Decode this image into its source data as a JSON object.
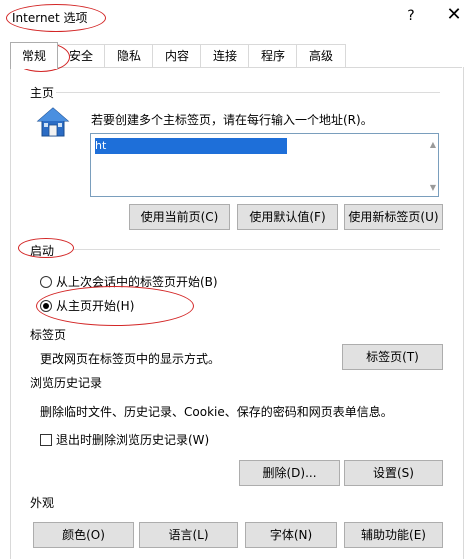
{
  "window": {
    "title": "Internet 选项",
    "help": "?",
    "close": "✕"
  },
  "tabs": [
    {
      "label": "常规",
      "active": true
    },
    {
      "label": "安全",
      "active": false
    },
    {
      "label": "隐私",
      "active": false
    },
    {
      "label": "内容",
      "active": false
    },
    {
      "label": "连接",
      "active": false
    },
    {
      "label": "程序",
      "active": false
    },
    {
      "label": "高级",
      "active": false
    }
  ],
  "home": {
    "header": "主页",
    "description": "若要创建多个主标签页，请在每行输入一个地址(R)。",
    "url_value": "ht",
    "buttons": {
      "use_current": "使用当前页(C)",
      "use_default": "使用默认值(F)",
      "use_new_tab": "使用新标签页(U)"
    }
  },
  "startup": {
    "header": "启动",
    "options": [
      {
        "label": "从上次会话中的标签页开始(B)",
        "selected": false
      },
      {
        "label": "从主页开始(H)",
        "selected": true
      }
    ]
  },
  "tabs_section": {
    "header": "标签页",
    "description": "更改网页在标签页中的显示方式。",
    "button": "标签页(T)"
  },
  "history": {
    "header": "浏览历史记录",
    "description": "删除临时文件、历史记录、Cookie、保存的密码和网页表单信息。",
    "checkbox_label": "退出时删除浏览历史记录(W)",
    "checkbox_checked": false,
    "delete_button": "删除(D)...",
    "settings_button": "设置(S)"
  },
  "appearance": {
    "header": "外观",
    "buttons": {
      "colors": "颜色(O)",
      "languages": "语言(L)",
      "fonts": "字体(N)",
      "accessibility": "辅助功能(E)"
    }
  },
  "icons": {
    "home": "house-icon",
    "scroll_up": "chevron-up-icon",
    "scroll_down": "chevron-down-icon"
  },
  "colors": {
    "annotation": "#d32626",
    "selection": "#1e6fd9"
  }
}
